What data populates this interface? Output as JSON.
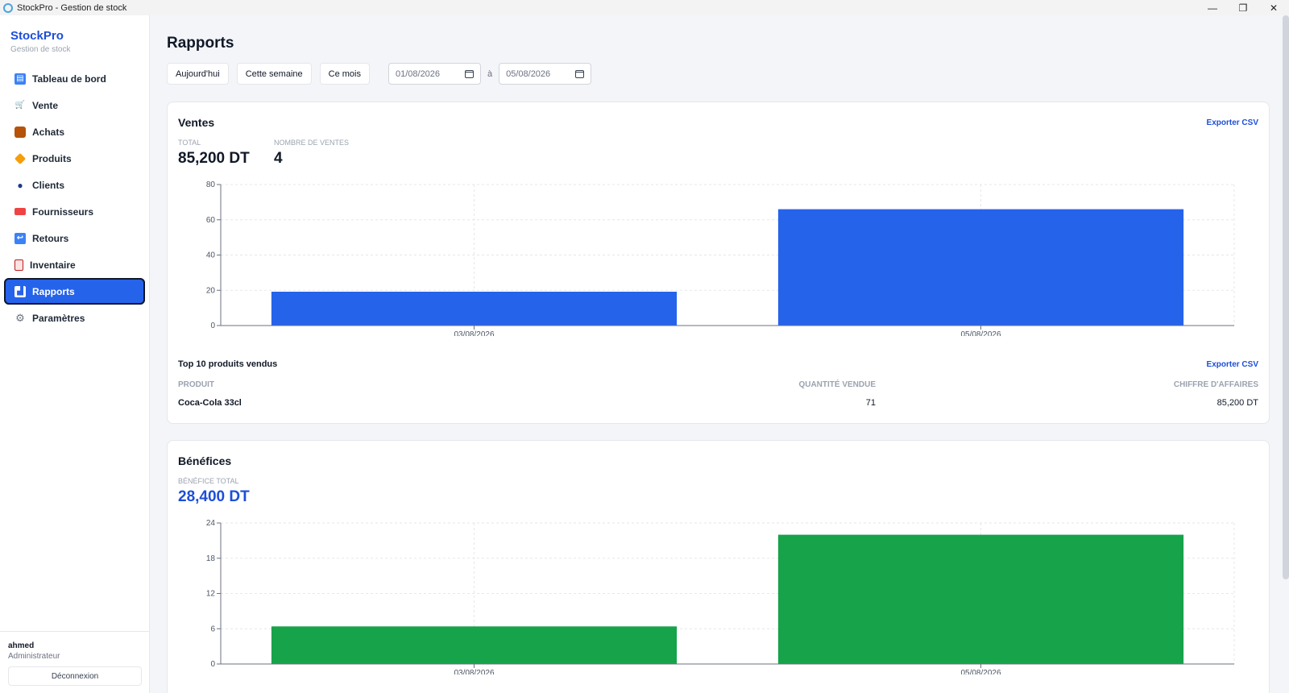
{
  "window": {
    "title": "StockPro - Gestion de stock"
  },
  "brand": {
    "name": "StockPro",
    "subtitle": "Gestion de stock"
  },
  "sidebar": {
    "items": [
      {
        "label": "Tableau de bord",
        "icon": "dashboard-icon",
        "active": false
      },
      {
        "label": "Vente",
        "icon": "cart-icon",
        "active": false
      },
      {
        "label": "Achats",
        "icon": "box-icon",
        "active": false
      },
      {
        "label": "Produits",
        "icon": "tag-icon",
        "active": false
      },
      {
        "label": "Clients",
        "icon": "user-icon",
        "active": false
      },
      {
        "label": "Fournisseurs",
        "icon": "truck-icon",
        "active": false
      },
      {
        "label": "Retours",
        "icon": "return-icon",
        "active": false
      },
      {
        "label": "Inventaire",
        "icon": "clipboard-icon",
        "active": false
      },
      {
        "label": "Rapports",
        "icon": "chart-icon",
        "active": true
      },
      {
        "label": "Paramètres",
        "icon": "gear-icon",
        "active": false
      }
    ]
  },
  "user": {
    "name": "ahmed",
    "role": "Administrateur",
    "logout_label": "Déconnexion"
  },
  "page": {
    "title": "Rapports"
  },
  "filters": {
    "today": "Aujourd'hui",
    "week": "Cette semaine",
    "month": "Ce mois",
    "date_from": "01/08/2026",
    "separator": "à",
    "date_to": "05/08/2026"
  },
  "sales": {
    "title": "Ventes",
    "export_label": "Exporter CSV",
    "total_label": "TOTAL",
    "total_value": "85,200 DT",
    "count_label": "NOMBRE DE VENTES",
    "count_value": "4"
  },
  "top_products": {
    "title": "Top 10 produits vendus",
    "export_label": "Exporter CSV",
    "headers": {
      "product": "PRODUIT",
      "qty": "QUANTITÉ VENDUE",
      "revenue": "CHIFFRE D'AFFAIRES"
    },
    "rows": [
      {
        "product": "Coca-Cola 33cl",
        "qty": "71",
        "revenue": "85,200 DT"
      }
    ]
  },
  "profit": {
    "title": "Bénéfices",
    "total_label": "BÉNÉFICE TOTAL",
    "total_value": "28,400 DT"
  },
  "colors": {
    "accent": "#2563eb",
    "sales_bar": "#2563eb",
    "profit_bar": "#16a34a",
    "link": "#1d4ed8"
  },
  "chart_data": [
    {
      "type": "bar",
      "categories": [
        "03/08/2026",
        "05/08/2026"
      ],
      "values": [
        19.2,
        66
      ],
      "yticks": [
        0,
        20,
        40,
        60,
        80
      ],
      "ylim": [
        0,
        80
      ],
      "grid": true,
      "color": "#2563eb"
    },
    {
      "type": "bar",
      "categories": [
        "03/08/2026",
        "05/08/2026"
      ],
      "values": [
        6.4,
        22
      ],
      "yticks": [
        0,
        6,
        12,
        18,
        24
      ],
      "ylim": [
        0,
        24
      ],
      "grid": true,
      "color": "#16a34a"
    }
  ]
}
